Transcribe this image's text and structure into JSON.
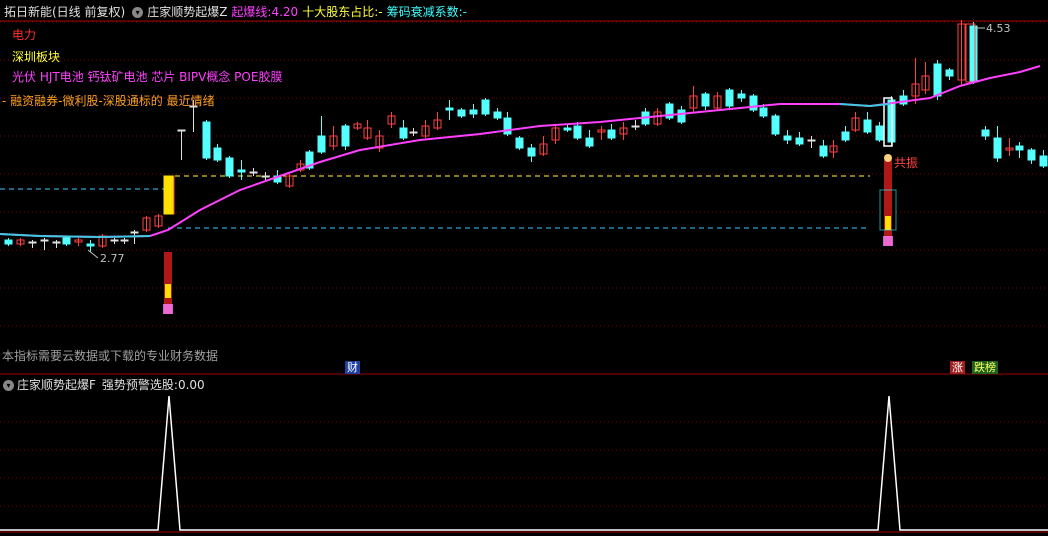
{
  "main_header": {
    "stock": "拓日新能(日线 前复权)",
    "indicator": "庄家顺势起爆Z",
    "burst_label": "起爆线:",
    "burst_value": "4.20",
    "holder_label": "十大股东占比:",
    "holder_value": "-",
    "chip_label": "筹码衰减系数:",
    "chip_value": "-"
  },
  "industry_tags": {
    "industry": "电力",
    "board": "深圳板块",
    "concepts": "光伏 HJT电池 钙钛矿电池 芯片 BIPV概念 POE胶膜",
    "misc": "- 融资融券-微利股-深股通标的 最近情绪"
  },
  "annotations": {
    "high_price": "4.53",
    "low_price": "2.77",
    "resonance": "共振",
    "notice": "本指标需要云数据或下载的专业财务数据",
    "finance_badge": "财",
    "rise_badge": "涨",
    "list_badge": "跌榜"
  },
  "sub_header": {
    "indicator": "庄家顺势起爆F",
    "warn_label": "强势预警选股:",
    "warn_value": "0.00"
  },
  "colors": {
    "up": "#ff4040",
    "down": "#54ffff",
    "ma": "#ff40ff",
    "yellow_line": "#ffff40",
    "cyan_line": "#40c8ff",
    "grid": "#7a0000"
  },
  "chart_data": {
    "type": "candlestick",
    "price_markers": {
      "high": 4.53,
      "low": 2.77,
      "burst_line": 4.2
    },
    "signal_series": {
      "name": "强势预警选股",
      "values": [
        0,
        0,
        1,
        0,
        0,
        1,
        0
      ],
      "note_positions": [
        "start",
        "",
        "peak1",
        "",
        "",
        "peak2",
        "end"
      ]
    }
  }
}
